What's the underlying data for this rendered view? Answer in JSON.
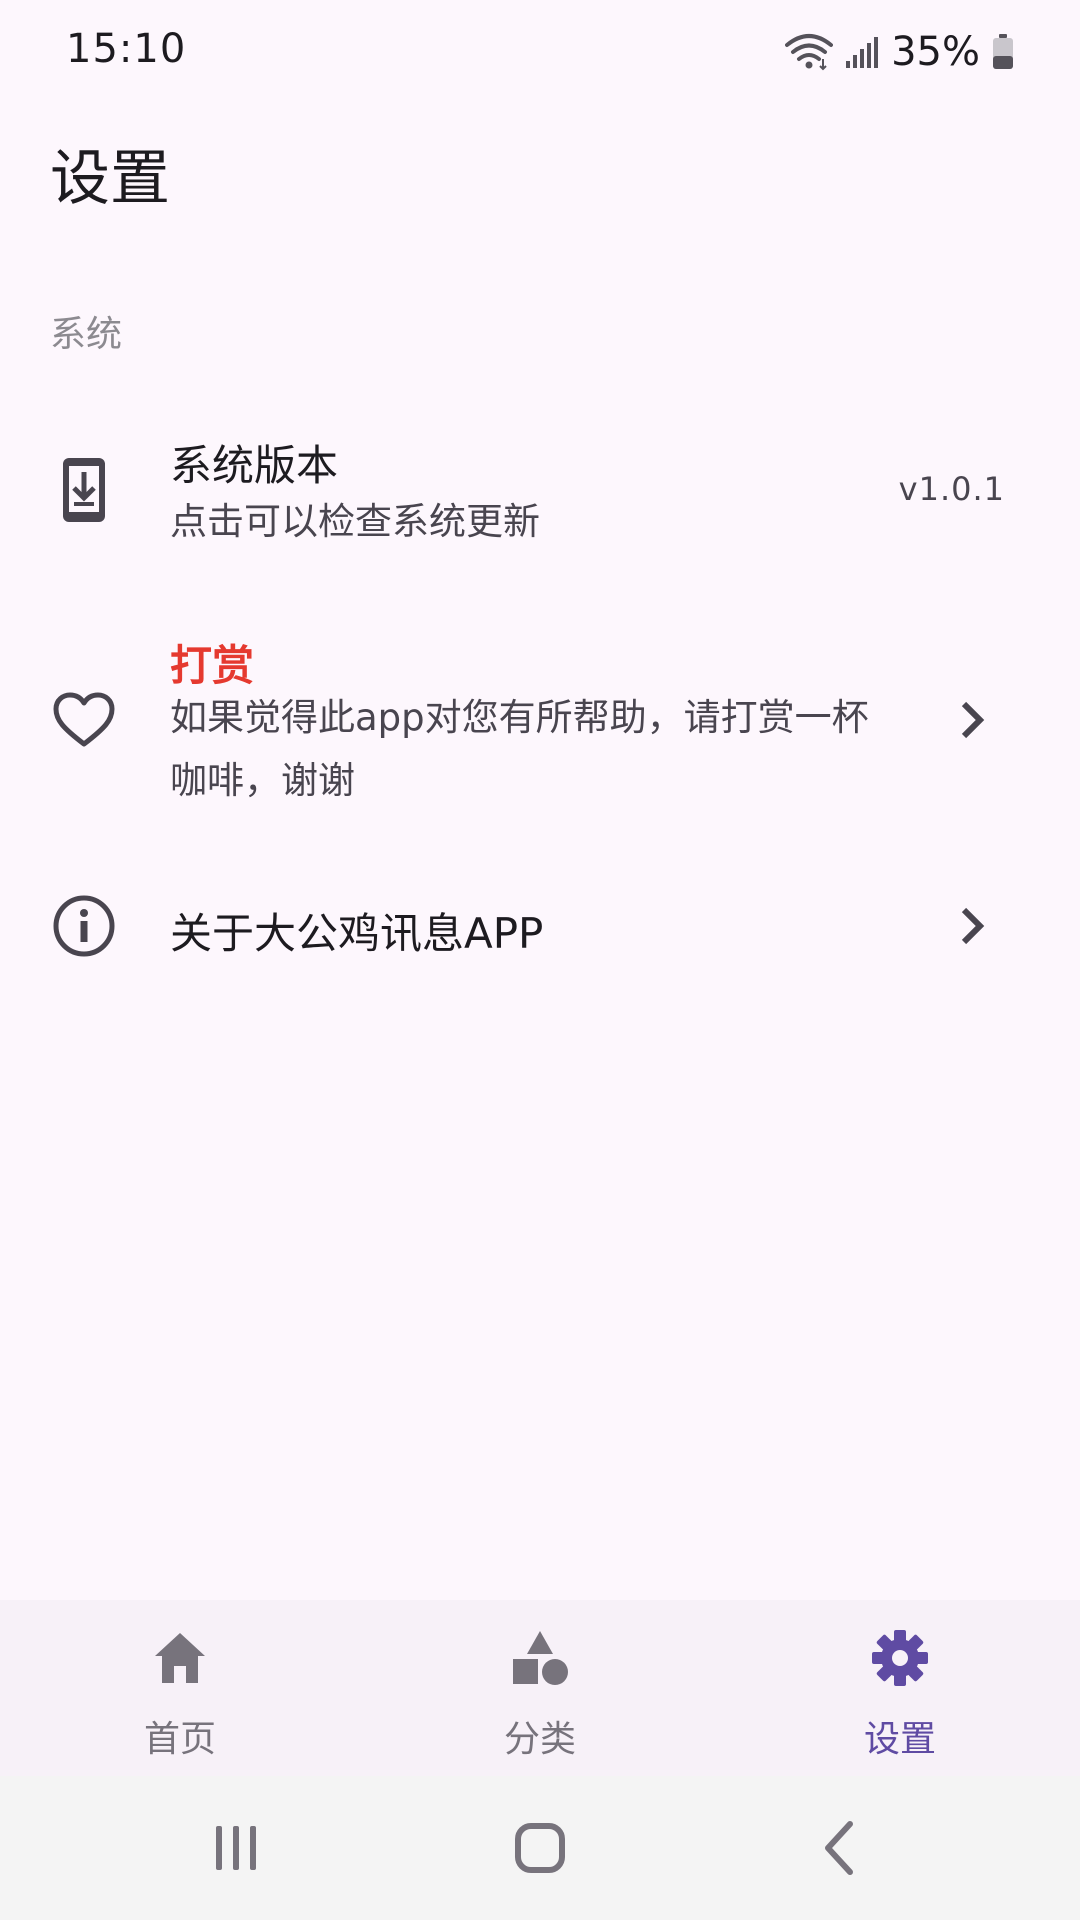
{
  "status_bar": {
    "time": "15:10",
    "battery": "35%"
  },
  "page": {
    "title": "设置"
  },
  "section": {
    "header": "系统"
  },
  "settings": {
    "version": {
      "title": "系统版本",
      "subtitle": "点击可以检查系统更新",
      "value": "v1.0.1",
      "icon": "phone-download-icon"
    },
    "reward": {
      "title": "打赏",
      "subtitle": "如果觉得此app对您有所帮助，请打赏一杯咖啡，谢谢",
      "icon": "heart-outline-icon",
      "title_color": "#E5392F"
    },
    "about": {
      "title": "关于大公鸡讯息APP",
      "icon": "info-icon"
    }
  },
  "bottom_nav": {
    "items": [
      {
        "label": "首页",
        "icon": "home-icon",
        "active": false
      },
      {
        "label": "分类",
        "icon": "category-shapes-icon",
        "active": false
      },
      {
        "label": "设置",
        "icon": "gear-icon",
        "active": true
      }
    ],
    "active_color": "#5F4BA3",
    "inactive_color": "#77737C"
  },
  "colors": {
    "background": "#FDF7FD",
    "nav_background": "#F7F1F8",
    "accent": "#5F4BA3"
  }
}
